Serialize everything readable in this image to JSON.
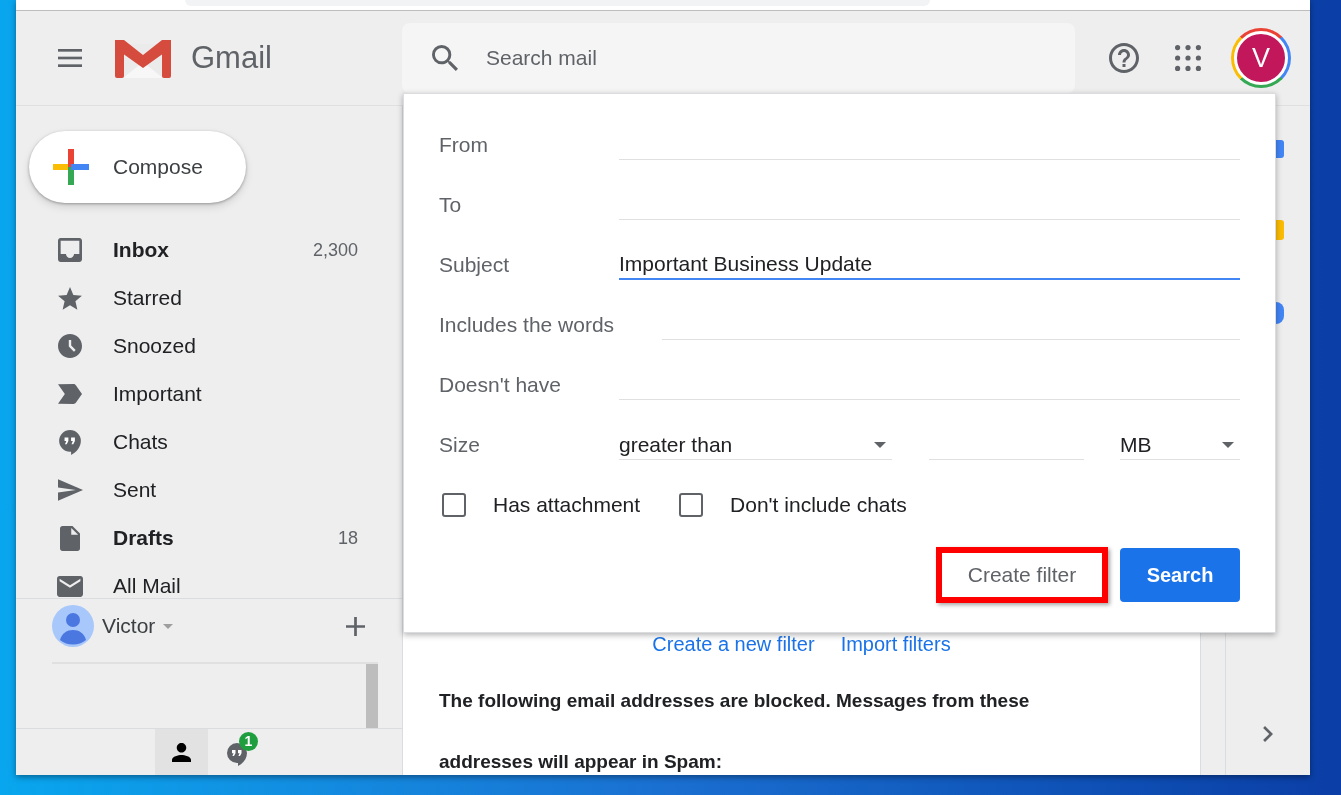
{
  "header": {
    "product_name": "Gmail",
    "search": {
      "placeholder": "Search mail"
    },
    "account": {
      "initial": "V"
    }
  },
  "compose": {
    "label": "Compose"
  },
  "nav": [
    {
      "label": "Inbox",
      "count": "2,300",
      "unread": true
    },
    {
      "label": "Starred",
      "unread": false
    },
    {
      "label": "Snoozed",
      "unread": false
    },
    {
      "label": "Important",
      "unread": false
    },
    {
      "label": "Chats",
      "unread": false
    },
    {
      "label": "Sent",
      "unread": false
    },
    {
      "label": "Drafts",
      "count": "18",
      "unread": true
    },
    {
      "label": "All Mail",
      "unread": false
    }
  ],
  "hangouts": {
    "user": "Victor",
    "tabs": [
      {
        "selected": true
      },
      {
        "selected": false,
        "badge": "1"
      }
    ]
  },
  "filter": {
    "fields": [
      {
        "label": "From",
        "focused": false
      },
      {
        "label": "To",
        "focused": false
      },
      {
        "label": "Subject",
        "value": "Important Business Update",
        "focused": true
      },
      {
        "label": "Includes the words",
        "focused": false
      },
      {
        "label": "Doesn't have",
        "focused": false
      }
    ],
    "size": {
      "label": "Size",
      "comparator": "greater than",
      "unit": "MB"
    },
    "checkboxes": [
      {
        "label": "Has attachment",
        "checked": false
      },
      {
        "label": "Don't include chats",
        "checked": false
      }
    ],
    "create_filter": {
      "label": "Create filter",
      "highlighted": true
    },
    "search_button": {
      "label": "Search"
    }
  },
  "filters_page": {
    "links": [
      "Create a new filter",
      "Import filters"
    ],
    "blocked_notice": "The following email addresses are blocked. Messages from these addresses will appear in Spam:"
  }
}
